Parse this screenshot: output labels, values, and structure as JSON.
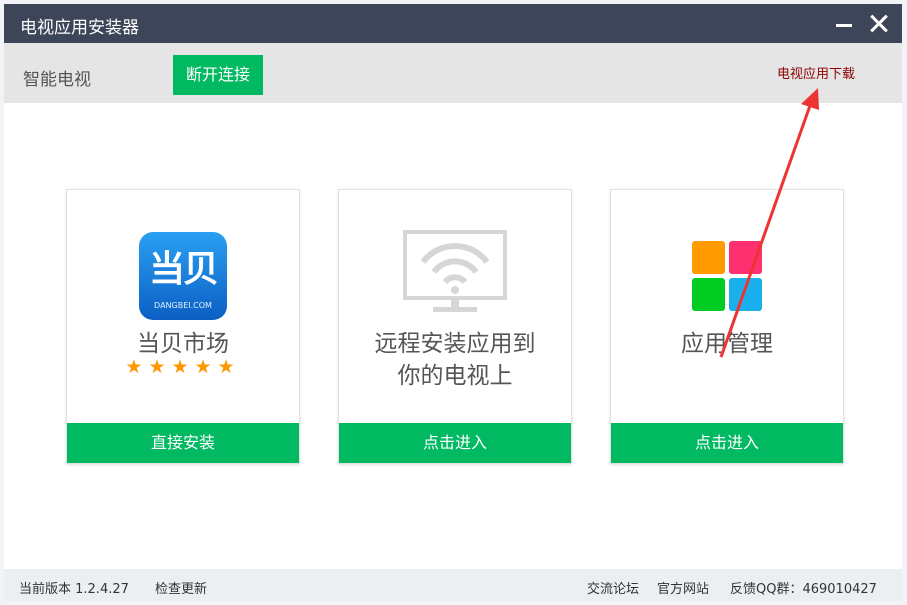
{
  "window": {
    "title": "电视应用安装器"
  },
  "toolbar": {
    "device_name": "智能电视",
    "disconnect_label": "断开连接",
    "download_link": "电视应用下载"
  },
  "cards": [
    {
      "title": "当贝市场",
      "button": "直接安装",
      "logo_text": "当贝",
      "logo_subtext": "DANGBEI.COM",
      "stars": "★★★★★"
    },
    {
      "title_line1": "远程安装应用到",
      "title_line2": "你的电视上",
      "button": "点击进入"
    },
    {
      "title": "应用管理",
      "button": "点击进入"
    }
  ],
  "status": {
    "version": "当前版本 1.2.4.27",
    "check_update": "检查更新",
    "forum": "交流论坛",
    "website": "官方网站",
    "feedback": "反馈QQ群：469010427"
  },
  "colors": {
    "titlebar": "#3d4658",
    "accent_green": "#00b961",
    "annotation_arrow": "#ee3333"
  }
}
